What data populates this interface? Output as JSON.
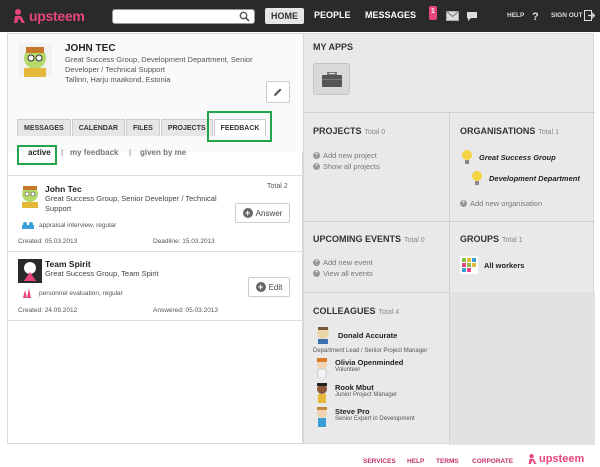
{
  "header": {
    "logo_text": "upsteem",
    "search": {
      "placeholder": "",
      "value": ""
    },
    "nav": [
      "HOME",
      "PEOPLE",
      "MESSAGES"
    ],
    "notification_count": "1",
    "help": "HELP",
    "sign_out": "SIGN OUT",
    "colors": {
      "bar": "#2a2a2a",
      "brand": "#e8457f"
    }
  },
  "profile": {
    "name": "JOHN TEC",
    "job_line1": "Great Success Group, Development Department, Senior",
    "job_line2": "Developer / Technical Support",
    "location": "Tallinn, Harju maakond, Estonia"
  },
  "tabs": [
    "MESSAGES",
    "CALENDAR",
    "FILES",
    "PROJECTS",
    "FEEDBACK"
  ],
  "subtabs": {
    "active": "active",
    "my": "my feedback",
    "given": "given by me",
    "total": "Total 2"
  },
  "feedback_items": [
    {
      "name": "John Tec",
      "sub": "Great Success Group, Senior Developer / Technical Support",
      "type": "appraisal interview, regular",
      "created": "Created: 05.03.2013",
      "deadline": "Deadline: 15.03.2013",
      "action": "Answer"
    },
    {
      "name": "Team Spirit",
      "sub": "Great Success Group, Team Spirit",
      "type": "personnel evaluation, regular",
      "created": "Created: 24.09.2012",
      "deadline": "Answered: 05.03.2013",
      "action": "Edit"
    }
  ],
  "right": {
    "my_apps": "MY APPS",
    "projects": {
      "title": "PROJECTS",
      "total": "Total 0",
      "links": [
        "Add new project",
        "Show all projects"
      ]
    },
    "organisations": {
      "title": "ORGANISATIONS",
      "total": "Total 1",
      "items": [
        "Great Success Group",
        "Development Department"
      ],
      "add": "Add new organisation"
    },
    "events": {
      "title": "UPCOMING EVENTS",
      "total": "Total 0",
      "links": [
        "Add new event",
        "View all events"
      ]
    },
    "groups": {
      "title": "GROUPS",
      "total": "Total 1",
      "items": [
        "All workers"
      ]
    },
    "colleagues": {
      "title": "COLLEAGUES",
      "total": "Total 4",
      "items": [
        {
          "name": "Donald Accurate",
          "role": "Department Lead / Senior Project Manager"
        },
        {
          "name": "Olivia Openminded",
          "role": "Volunteer"
        },
        {
          "name": "Rook Mbut",
          "role": "Junior Project Manager"
        },
        {
          "name": "Steve Pro",
          "role": "Senior Expert in Development"
        }
      ]
    }
  },
  "footer": {
    "links": [
      "SERVICES",
      "HELP",
      "TERMS",
      "CORPORATE"
    ],
    "logo": "upsteem"
  }
}
